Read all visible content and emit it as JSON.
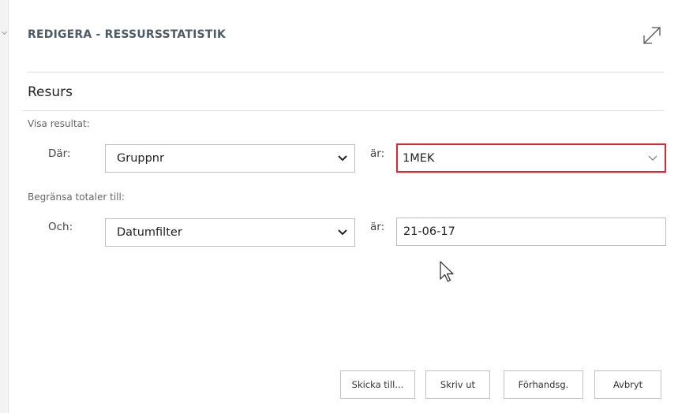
{
  "dialog": {
    "title": "REDIGERA - RESSURSSTATISTIK",
    "section_title": "Resurs"
  },
  "show_results": {
    "label": "Visa resultat:",
    "where_label": "Där:",
    "field_value": "Gruppnr",
    "is_label": "är:",
    "filter_value": "1MEK"
  },
  "limit_totals": {
    "label": "Begränsa totaler till:",
    "and_label": "Och:",
    "field_value": "Datumfilter",
    "is_label": "är:",
    "filter_value": "21-06-17"
  },
  "buttons": {
    "send_to": "Skicka till...",
    "print": "Skriv ut",
    "preview": "Förhandsg.",
    "cancel": "Avbryt"
  },
  "colors": {
    "highlight": "#e3242b",
    "title": "#4d5b66"
  },
  "icons": [
    "expand-icon",
    "chevron-down-icon",
    "mouse-pointer-icon"
  ]
}
